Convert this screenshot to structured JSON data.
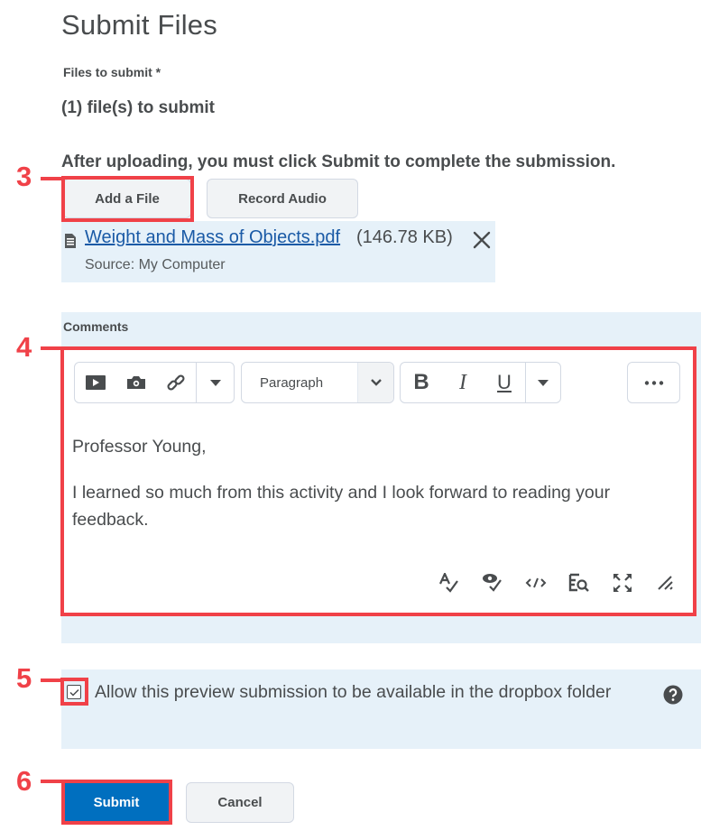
{
  "page": {
    "title": "Submit Files",
    "files_label": "Files to submit *",
    "files_count": "(1) file(s) to submit",
    "upload_note": "After uploading, you must click Submit to complete the submission."
  },
  "upload_buttons": {
    "add_file": "Add a File",
    "record_audio": "Record Audio"
  },
  "attached_file": {
    "icon": "document-icon",
    "name": "Weight and Mass of Objects.pdf",
    "size": "(146.78 KB)",
    "source": "Source: My Computer",
    "remove_icon": "close-icon"
  },
  "comments": {
    "label": "Comments",
    "toolbar": {
      "insert_group": [
        "insert-video-icon",
        "insert-image-icon",
        "insert-link-icon",
        "more-insert-dropdown-icon"
      ],
      "block_format": "Paragraph",
      "format_group": [
        "bold-icon",
        "italic-icon",
        "underline-icon",
        "more-format-dropdown-icon"
      ],
      "more_actions": "more-actions-icon"
    },
    "body": [
      "Professor Young,",
      "I learned so much from this activity and I look forward to reading your feedback."
    ],
    "status_icons": [
      "spellcheck-icon",
      "accessibility-check-icon",
      "source-code-icon",
      "preview-icon",
      "fullscreen-icon",
      "resize-handle-icon"
    ]
  },
  "preview": {
    "checked": true,
    "label": "Allow this preview submission to be available in the dropbox folder",
    "help_icon": "help-icon"
  },
  "actions": {
    "submit": "Submit",
    "cancel": "Cancel"
  },
  "annotations": {
    "steps": [
      "3",
      "4",
      "5",
      "6"
    ],
    "color": "#f04148"
  },
  "colors": {
    "primary": "#006fbf",
    "link": "#1a5aa6",
    "panel_bg": "#e6f1f9",
    "text": "#494c4e"
  }
}
